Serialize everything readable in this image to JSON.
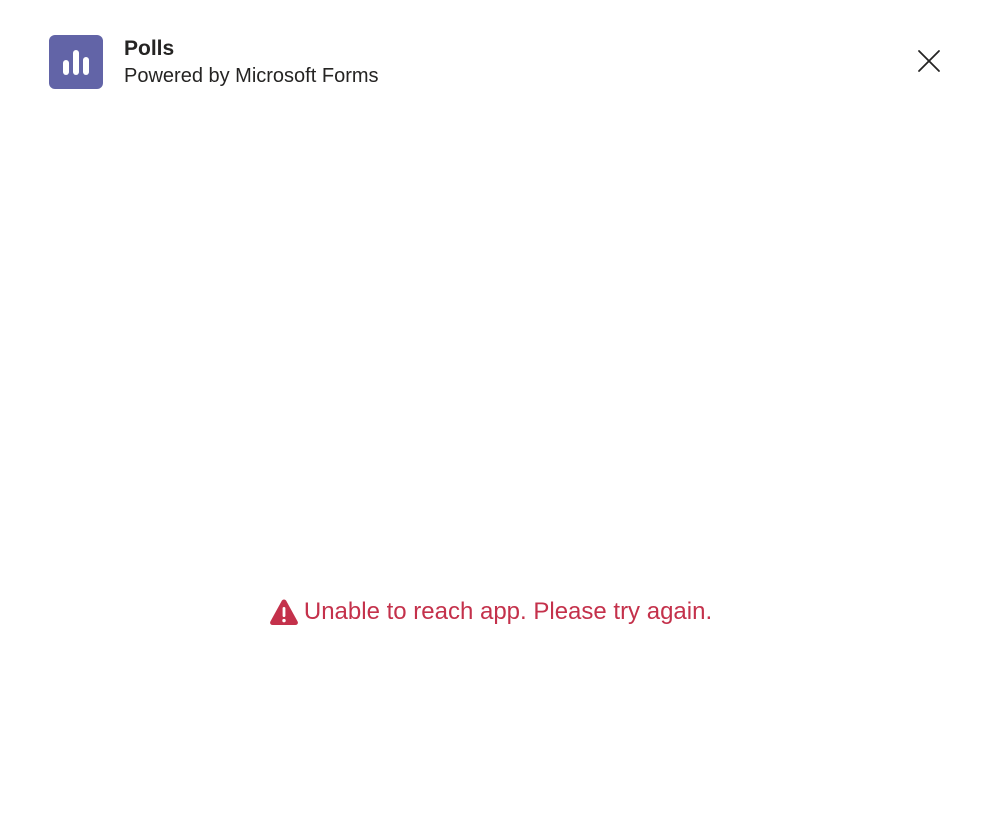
{
  "header": {
    "title": "Polls",
    "subtitle": "Powered by Microsoft Forms",
    "icon": "bar-chart-icon",
    "close_icon": "close-icon"
  },
  "error": {
    "message": "Unable to reach app. Please try again.",
    "icon": "warning-icon"
  },
  "colors": {
    "app_icon_bg": "#6264a7",
    "error": "#c4314b",
    "text": "#252423",
    "background": "#ffffff"
  }
}
